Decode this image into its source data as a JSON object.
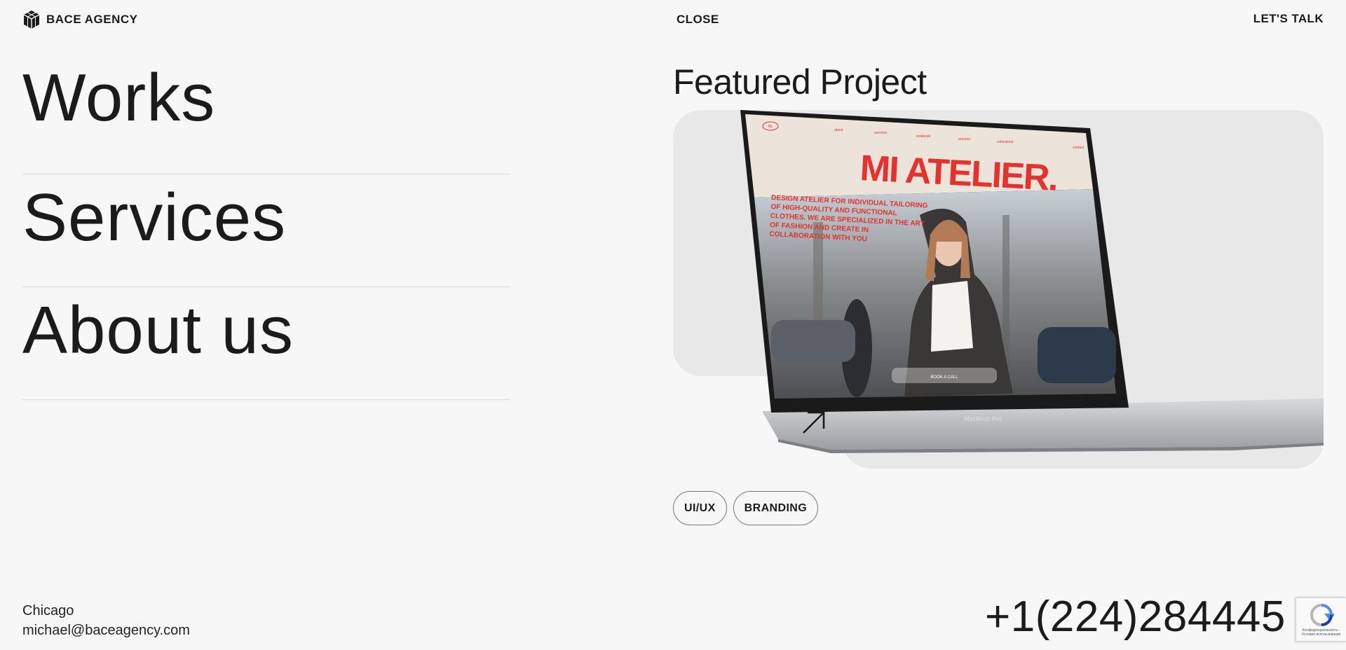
{
  "header": {
    "brand": "BACE AGENCY",
    "close_label": "CLOSE",
    "talk_label": "LET'S TALK"
  },
  "menu": {
    "items": [
      {
        "label": "Works"
      },
      {
        "label": "Services"
      },
      {
        "label": "About us"
      }
    ]
  },
  "featured": {
    "title": "Featured Project",
    "screen": {
      "nav": [
        "about",
        "services",
        "lookbook",
        "process",
        "collections",
        "contact"
      ],
      "logo": "ML",
      "headline": "MI ATELIER.",
      "description": [
        "DESIGN ATELIER FOR INDIVIDUAL TAILORING",
        "OF HIGH-QUALITY AND FUNCTIONAL",
        "CLOTHES. WE ARE SPECIALIZED IN THE ART",
        "OF FASHION AND CREATE IN",
        "COLLABORATION WITH YOU"
      ],
      "cta": "BOOK A CALL",
      "laptop_label": "MacBook Pro"
    },
    "tags": [
      "UI/UX",
      "BRANDING"
    ]
  },
  "footer": {
    "city": "Chicago",
    "email": "michael@baceagency.com",
    "phone": "+1(224)284445"
  },
  "recaptcha": {
    "text": "Конфиденциальность - Условия использования"
  },
  "colors": {
    "background": "#f7f7f7",
    "card": "#e8e8e8",
    "text": "#1b1b1b",
    "accent_red": "#e5322d"
  }
}
